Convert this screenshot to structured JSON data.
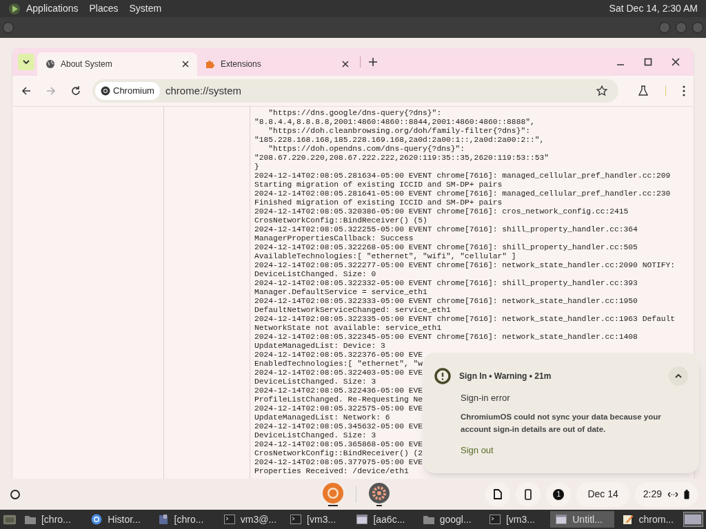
{
  "top_panel": {
    "menus": [
      "Applications",
      "Places",
      "System"
    ],
    "clock": "Sat Dec 14, 2:30 AM"
  },
  "browser": {
    "tabs": [
      {
        "title": "About System",
        "selected": true,
        "kind": "globe"
      },
      {
        "title": "Extensions",
        "selected": false,
        "kind": "puzzle"
      }
    ],
    "chip": "Chromium",
    "url": "chrome://system",
    "log": [
      "   \"https://dns.google/dns-query{?dns}\":",
      "\"8.8.4.4,8.8.8.8,2001:4860:4860::8844,2001:4860:4860::8888\",",
      "   \"https://doh.cleanbrowsing.org/doh/family-filter{?dns}\":",
      "\"185.228.168.168,185.228.169.168,2a0d:2a00:1::,2a0d:2a00:2::\",",
      "   \"https://doh.opendns.com/dns-query{?dns}\":",
      "\"208.67.220.220,208.67.222.222,2620:119:35::35,2620:119:53::53\"",
      "}",
      "2024-12-14T02:08:05.281634-05:00 EVENT chrome[7616]: managed_cellular_pref_handler.cc:209",
      "Starting migration of existing ICCID and SM-DP+ pairs",
      "2024-12-14T02:08:05.281641-05:00 EVENT chrome[7616]: managed_cellular_pref_handler.cc:230",
      "Finished migration of existing ICCID and SM-DP+ pairs",
      "2024-12-14T02:08:05.320386-05:00 EVENT chrome[7616]: cros_network_config.cc:2415",
      "CrosNetworkConfig::BindReceiver() (5)",
      "2024-12-14T02:08:05.322255-05:00 EVENT chrome[7616]: shill_property_handler.cc:364",
      "ManagerPropertiesCallback: Success",
      "2024-12-14T02:08:05.322268-05:00 EVENT chrome[7616]: shill_property_handler.cc:505",
      "AvailableTechnologies:[ \"ethernet\", \"wifi\", \"cellular\" ]",
      "2024-12-14T02:08:05.322277-05:00 EVENT chrome[7616]: network_state_handler.cc:2090 NOTIFY:",
      "DeviceListChanged. Size: 0",
      "2024-12-14T02:08:05.322332-05:00 EVENT chrome[7616]: shill_property_handler.cc:393",
      "Manager.DefaultService = service_eth1",
      "2024-12-14T02:08:05.322333-05:00 EVENT chrome[7616]: network_state_handler.cc:1950",
      "DefaultNetworkServiceChanged: service_eth1",
      "2024-12-14T02:08:05.322335-05:00 EVENT chrome[7616]: network_state_handler.cc:1963 Default",
      "NetworkState not available: service_eth1",
      "2024-12-14T02:08:05.322345-05:00 EVENT chrome[7616]: network_state_handler.cc:1408",
      "UpdateManagedList: Device: 3",
      "2024-12-14T02:08:05.322376-05:00 EVE",
      "EnabledTechnologies:[ \"ethernet\", \"w",
      "2024-12-14T02:08:05.322403-05:00 EVE",
      "DeviceListChanged. Size: 3",
      "2024-12-14T02:08:05.322436-05:00 EVE",
      "ProfileListChanged. Re-Requesting Ne",
      "2024-12-14T02:08:05.322575-05:00 EVE",
      "UpdateManagedList: Network: 6",
      "2024-12-14T02:08:05.345632-05:00 EVE",
      "DeviceListChanged. Size: 3",
      "2024-12-14T02:08:05.365868-05:00 EVE",
      "CrosNetworkConfig::BindReceiver() (2",
      "2024-12-14T02:08:05.377975-05:00 EVE",
      "Properties Received: /device/eth1"
    ]
  },
  "notification": {
    "header": "Sign In • Warning • 21m",
    "title": "Sign-in error",
    "body": "ChromiumOS could not sync your data because your account sign-in details are out of date.",
    "action": "Sign out"
  },
  "shelf": {
    "notification_count": "1",
    "date": "Dec 14",
    "time": "2:29"
  },
  "taskbar": [
    {
      "label": "[chro...",
      "kind": "folder"
    },
    {
      "label": "Histor...",
      "kind": "browser"
    },
    {
      "label": "[chro...",
      "kind": "app"
    },
    {
      "label": "vm3@...",
      "kind": "terminal"
    },
    {
      "label": "[vm3...",
      "kind": "terminal"
    },
    {
      "label": "[aa6c...",
      "kind": "window"
    },
    {
      "label": "googl...",
      "kind": "folder"
    },
    {
      "label": "[vm3...",
      "kind": "terminal"
    },
    {
      "label": "Untitl...",
      "kind": "window",
      "selected": true
    },
    {
      "label": "chrom...",
      "kind": "editor"
    }
  ]
}
